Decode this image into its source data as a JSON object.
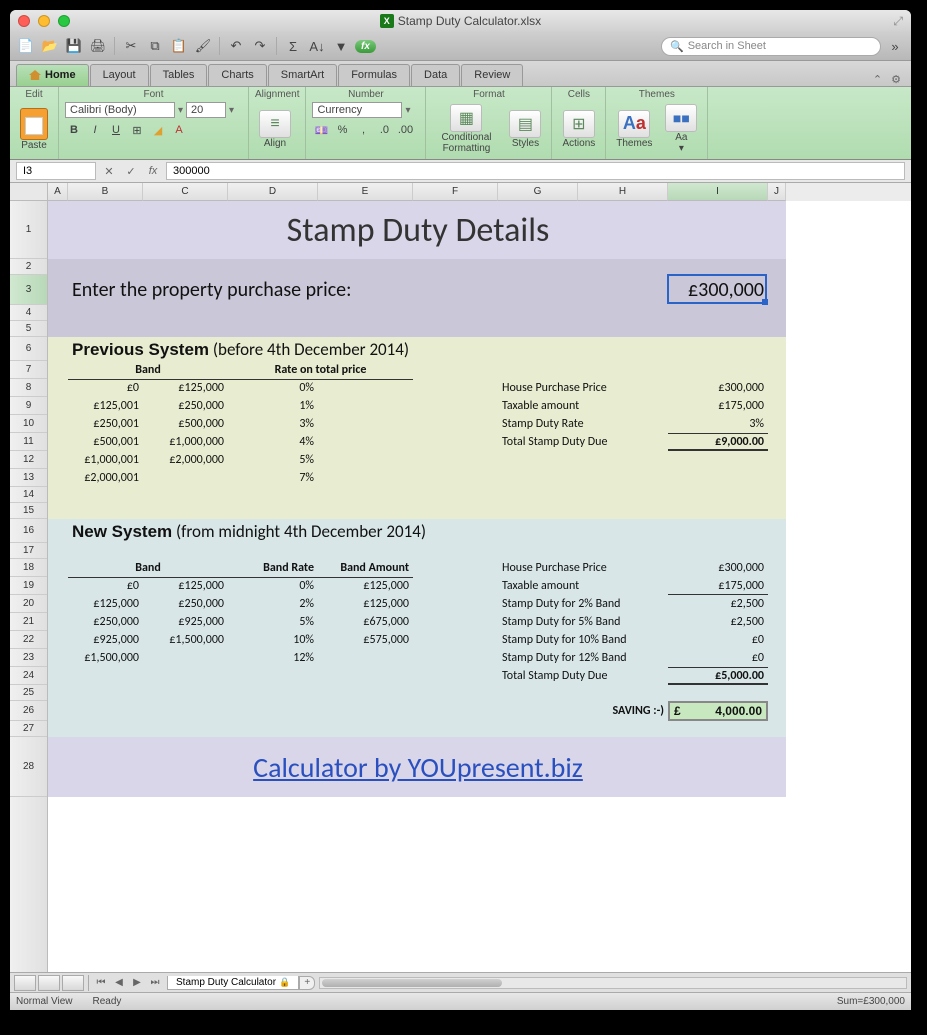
{
  "window": {
    "title": "Stamp Duty Calculator.xlsx"
  },
  "toolbar": {
    "search_placeholder": "Search in Sheet"
  },
  "ribbon_tabs": [
    "Home",
    "Layout",
    "Tables",
    "Charts",
    "SmartArt",
    "Formulas",
    "Data",
    "Review"
  ],
  "ribbon": {
    "groups": [
      "Edit",
      "Font",
      "Alignment",
      "Number",
      "Format",
      "Cells",
      "Themes"
    ],
    "paste": "Paste",
    "font_name": "Calibri (Body)",
    "font_size": "20",
    "number_format": "Currency",
    "align": "Align",
    "cond_fmt": "Conditional Formatting",
    "styles": "Styles",
    "actions": "Actions",
    "themes": "Themes",
    "aa": "Aa"
  },
  "formula_bar": {
    "name": "I3",
    "value": "300000"
  },
  "columns": [
    {
      "l": "A",
      "w": 20
    },
    {
      "l": "B",
      "w": 75
    },
    {
      "l": "C",
      "w": 85
    },
    {
      "l": "D",
      "w": 90
    },
    {
      "l": "E",
      "w": 95
    },
    {
      "l": "F",
      "w": 85
    },
    {
      "l": "G",
      "w": 80
    },
    {
      "l": "H",
      "w": 90
    },
    {
      "l": "I",
      "w": 100
    },
    {
      "l": "J",
      "w": 18
    }
  ],
  "rows": [
    {
      "n": 1,
      "h": 58
    },
    {
      "n": 2,
      "h": 16
    },
    {
      "n": 3,
      "h": 30
    },
    {
      "n": 4,
      "h": 16
    },
    {
      "n": 5,
      "h": 16
    },
    {
      "n": 6,
      "h": 24
    },
    {
      "n": 7,
      "h": 18
    },
    {
      "n": 8,
      "h": 18
    },
    {
      "n": 9,
      "h": 18
    },
    {
      "n": 10,
      "h": 18
    },
    {
      "n": 11,
      "h": 18
    },
    {
      "n": 12,
      "h": 18
    },
    {
      "n": 13,
      "h": 18
    },
    {
      "n": 14,
      "h": 16
    },
    {
      "n": 15,
      "h": 16
    },
    {
      "n": 16,
      "h": 24
    },
    {
      "n": 17,
      "h": 16
    },
    {
      "n": 18,
      "h": 18
    },
    {
      "n": 19,
      "h": 18
    },
    {
      "n": 20,
      "h": 18
    },
    {
      "n": 21,
      "h": 18
    },
    {
      "n": 22,
      "h": 18
    },
    {
      "n": 23,
      "h": 18
    },
    {
      "n": 24,
      "h": 18
    },
    {
      "n": 25,
      "h": 16
    },
    {
      "n": 26,
      "h": 20
    },
    {
      "n": 27,
      "h": 16
    },
    {
      "n": 28,
      "h": 60
    }
  ],
  "doc": {
    "title": "Stamp Duty Details",
    "input_label": "Enter the property purchase price:",
    "input_value": "£300,000",
    "prev_title_b": "Previous System",
    "prev_title_r": " (before 4th December 2014)",
    "prev_headers": {
      "band": "Band",
      "rate": "Rate on total price"
    },
    "prev_bands": [
      {
        "from": "£0",
        "to": "£125,000",
        "rate": "0%"
      },
      {
        "from": "£125,001",
        "to": "£250,000",
        "rate": "1%"
      },
      {
        "from": "£250,001",
        "to": "£500,000",
        "rate": "3%"
      },
      {
        "from": "£500,001",
        "to": "£1,000,000",
        "rate": "4%"
      },
      {
        "from": "£1,000,001",
        "to": "£2,000,000",
        "rate": "5%"
      },
      {
        "from": "£2,000,001",
        "to": "",
        "rate": "7%"
      }
    ],
    "prev_summary": [
      {
        "label": "House Purchase Price",
        "val": "£300,000"
      },
      {
        "label": "Taxable amount",
        "val": "£175,000"
      },
      {
        "label": "Stamp Duty Rate",
        "val": "3%"
      },
      {
        "label": "Total Stamp Duty Due",
        "val": "£9,000.00"
      }
    ],
    "new_title_b": "New System",
    "new_title_r": " (from midnight 4th December 2014)",
    "new_headers": {
      "band": "Band",
      "rate": "Band Rate",
      "amount": "Band Amount"
    },
    "new_bands": [
      {
        "from": "£0",
        "to": "£125,000",
        "rate": "0%",
        "amt": "£125,000"
      },
      {
        "from": "£125,000",
        "to": "£250,000",
        "rate": "2%",
        "amt": "£125,000"
      },
      {
        "from": "£250,000",
        "to": "£925,000",
        "rate": "5%",
        "amt": "£675,000"
      },
      {
        "from": "£925,000",
        "to": "£1,500,000",
        "rate": "10%",
        "amt": "£575,000"
      },
      {
        "from": "£1,500,000",
        "to": "",
        "rate": "12%",
        "amt": ""
      }
    ],
    "new_summary": [
      {
        "label": "House Purchase Price",
        "val": "£300,000"
      },
      {
        "label": "Taxable amount",
        "val": "£175,000"
      },
      {
        "label": "Stamp Duty for 2% Band",
        "val": "£2,500"
      },
      {
        "label": "Stamp Duty for 5% Band",
        "val": "£2,500"
      },
      {
        "label": "Stamp Duty for 10% Band",
        "val": "£0"
      },
      {
        "label": "Stamp Duty for 12% Band",
        "val": "£0"
      },
      {
        "label": "Total Stamp Duty Due",
        "val": "£5,000.00"
      }
    ],
    "saving_label": "SAVING :-)",
    "saving_cur": "£",
    "saving_val": "4,000.00",
    "footer": "Calculator by YOUpresent.biz"
  },
  "sheet_tab": "Stamp Duty Calculator",
  "status": {
    "view": "Normal View",
    "ready": "Ready",
    "sum": "Sum=£300,000"
  }
}
